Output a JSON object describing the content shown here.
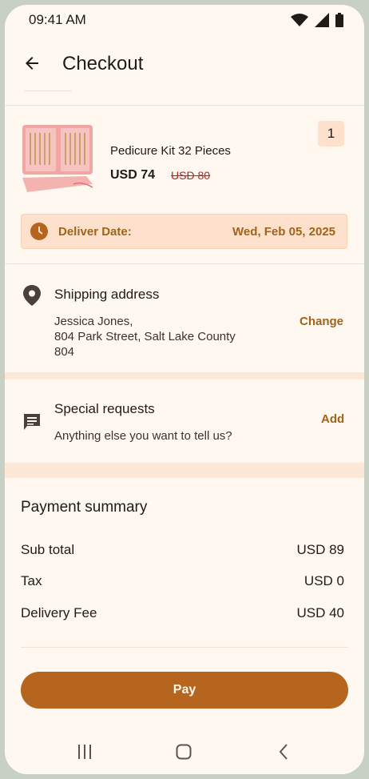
{
  "status_bar": {
    "time": "09:41 AM"
  },
  "header": {
    "title": "Checkout"
  },
  "product": {
    "name": "Pedicure Kit 32 Pieces",
    "price": "USD 74",
    "old_price": "USD 80",
    "quantity": "1"
  },
  "delivery": {
    "label": "Deliver Date:",
    "date": "Wed, Feb 05, 2025"
  },
  "shipping": {
    "title": "Shipping address",
    "lines": [
      "Jessica Jones,",
      "804 Park Street, Salt Lake County",
      "804"
    ],
    "action": "Change"
  },
  "special_requests": {
    "title": "Special requests",
    "subtitle": "Anything else you want to tell us?",
    "action": "Add"
  },
  "payment_summary": {
    "title": "Payment summary",
    "rows": [
      {
        "label": "Sub total",
        "value": "USD 89"
      },
      {
        "label": "Tax",
        "value": "USD 0"
      },
      {
        "label": "Delivery Fee",
        "value": "USD 40"
      }
    ]
  },
  "pay_button": {
    "label": "Pay"
  },
  "colors": {
    "accent": "#b5651d",
    "highlight": "#fde1cc",
    "background": "#fff8f1",
    "strike": "#b3261e"
  }
}
